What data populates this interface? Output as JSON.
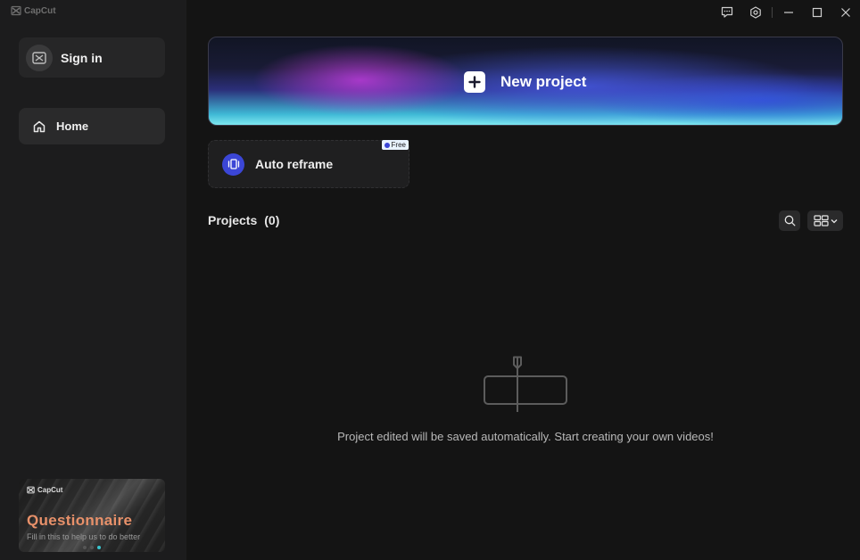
{
  "app": {
    "brand": "CapCut"
  },
  "sidebar": {
    "sign_in_label": "Sign in",
    "home_label": "Home",
    "promo": {
      "brand": "CapCut",
      "title": "Questionnaire",
      "subtitle": "Fill in this to help us to do better",
      "dots_total": 3,
      "active_dot": 3
    }
  },
  "main": {
    "new_project_label": "New project",
    "auto_reframe": {
      "label": "Auto reframe",
      "badge": "Free"
    },
    "projects": {
      "title": "Projects",
      "count": "(0)"
    },
    "empty_message": "Project edited will be saved automatically. Start creating your own videos!"
  },
  "colors": {
    "accent_blue": "#3b46d6",
    "promo_title": "#e8916a",
    "active_dot": "#39c5cf"
  },
  "icons": {
    "window": [
      "feedback-icon",
      "settings-icon",
      "minimize-icon",
      "maximize-icon",
      "close-icon"
    ]
  }
}
